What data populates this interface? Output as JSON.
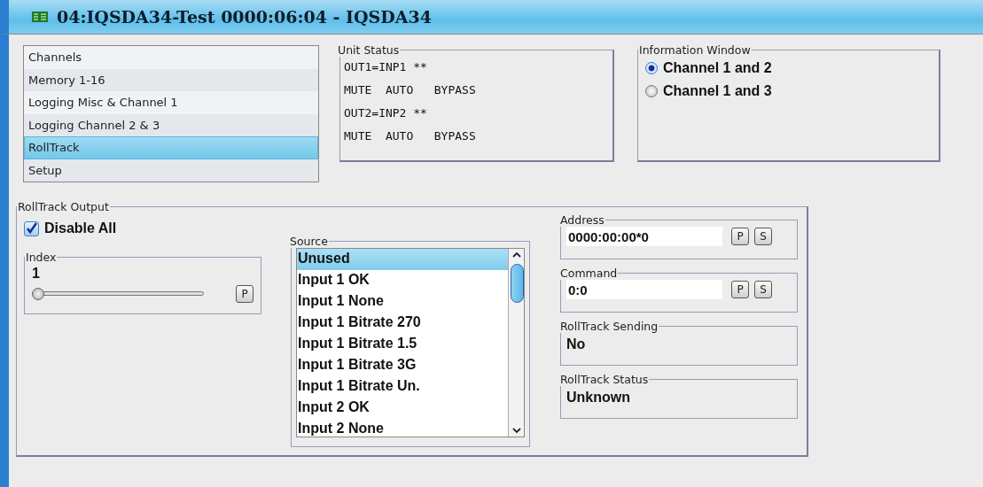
{
  "window": {
    "title": "04:IQSDA34-Test  0000:06:04  - IQSDA34"
  },
  "nav": {
    "items": [
      {
        "label": "Channels",
        "selected": false
      },
      {
        "label": "Memory 1-16",
        "selected": false
      },
      {
        "label": "Logging Misc & Channel 1",
        "selected": false
      },
      {
        "label": "Logging Channel 2 & 3",
        "selected": false
      },
      {
        "label": "RollTrack",
        "selected": true
      },
      {
        "label": "Setup",
        "selected": false
      }
    ]
  },
  "unit_status": {
    "title": "Unit Status",
    "lines": [
      "OUT1=INP1 **",
      "MUTE  AUTO   BYPASS",
      "OUT2=INP2 **",
      "MUTE  AUTO   BYPASS"
    ]
  },
  "information_window": {
    "title": "Information Window",
    "options": [
      {
        "label": "Channel 1 and 2",
        "selected": true
      },
      {
        "label": "Channel 1 and 3",
        "selected": false
      }
    ]
  },
  "rolltrack_output": {
    "title": "RollTrack Output",
    "disable_all": {
      "label": "Disable All",
      "checked": true
    },
    "index": {
      "title": "Index",
      "value": "1",
      "level": 0,
      "button": "P"
    },
    "source": {
      "title": "Source",
      "items": [
        {
          "label": "Unused",
          "selected": true
        },
        {
          "label": "Input 1 OK",
          "selected": false
        },
        {
          "label": "Input 1 None",
          "selected": false
        },
        {
          "label": "Input 1 Bitrate 270",
          "selected": false
        },
        {
          "label": "Input 1 Bitrate 1.5",
          "selected": false
        },
        {
          "label": "Input 1 Bitrate 3G",
          "selected": false
        },
        {
          "label": "Input 1 Bitrate Un.",
          "selected": false
        },
        {
          "label": "Input 2 OK",
          "selected": false
        },
        {
          "label": "Input 2 None",
          "selected": false
        }
      ]
    },
    "fields": [
      {
        "kind": "input",
        "title": "Address",
        "value": "0000:00:00*0",
        "buttons": [
          "P",
          "S"
        ]
      },
      {
        "kind": "input",
        "title": "Command",
        "value": "0:0",
        "buttons": [
          "P",
          "S"
        ]
      },
      {
        "kind": "readout",
        "title": "RollTrack Sending",
        "value": "No"
      },
      {
        "kind": "readout",
        "title": "RollTrack Status",
        "value": "Unknown"
      }
    ]
  }
}
